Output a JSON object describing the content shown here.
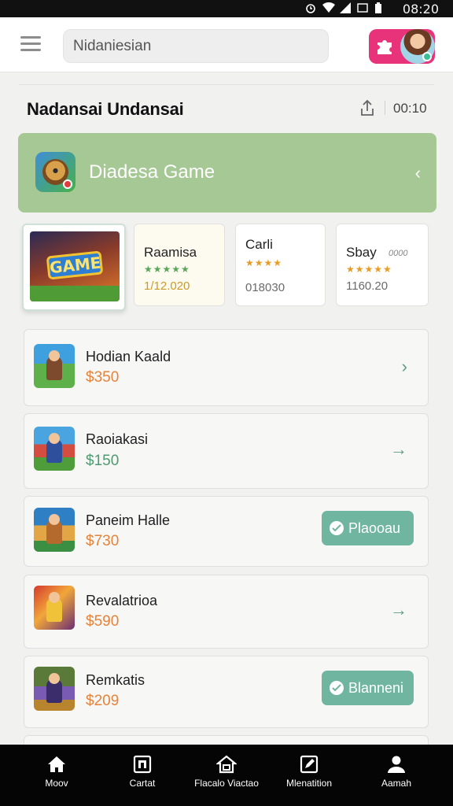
{
  "status_bar": {
    "time": "08:20"
  },
  "search": {
    "value": "Nidaniesian"
  },
  "section": {
    "title": "Nadansai Undansai",
    "count": "00:10"
  },
  "banner": {
    "title": "Diadesa Game"
  },
  "featured": {
    "logo_text": "GAME"
  },
  "cards": [
    {
      "title": "Raamisa",
      "stars": "★★★★★",
      "value": "1/12.020"
    },
    {
      "title": "Carli",
      "stars": "★★★★",
      "value": "018030"
    },
    {
      "title": "Sbay",
      "sub": "0000",
      "stars": "★★★★★",
      "value": "1160.20"
    }
  ],
  "items": [
    {
      "name": "Hodian Kaald",
      "price": "$350"
    },
    {
      "name": "Raoiakasi",
      "price": "$150"
    },
    {
      "name": "Paneim Halle",
      "price": "$730",
      "action": "Plaooau"
    },
    {
      "name": "Revalatrioa",
      "price": "$590"
    },
    {
      "name": "Remkatis",
      "price": "$209",
      "action": "Blanneni"
    }
  ],
  "nav": [
    {
      "label": "Moov",
      "icon": "home-icon"
    },
    {
      "label": "Cartat",
      "icon": "cart-icon"
    },
    {
      "label": "Flacalo Viactao",
      "icon": "store-icon"
    },
    {
      "label": "Mlenatition",
      "icon": "edit-icon"
    },
    {
      "label": "Aamah",
      "icon": "profile-icon"
    }
  ],
  "colors": {
    "banner": "#a6c894",
    "accent": "#6fb5a0",
    "price": "#e6833a",
    "brand": "#e8327a"
  }
}
